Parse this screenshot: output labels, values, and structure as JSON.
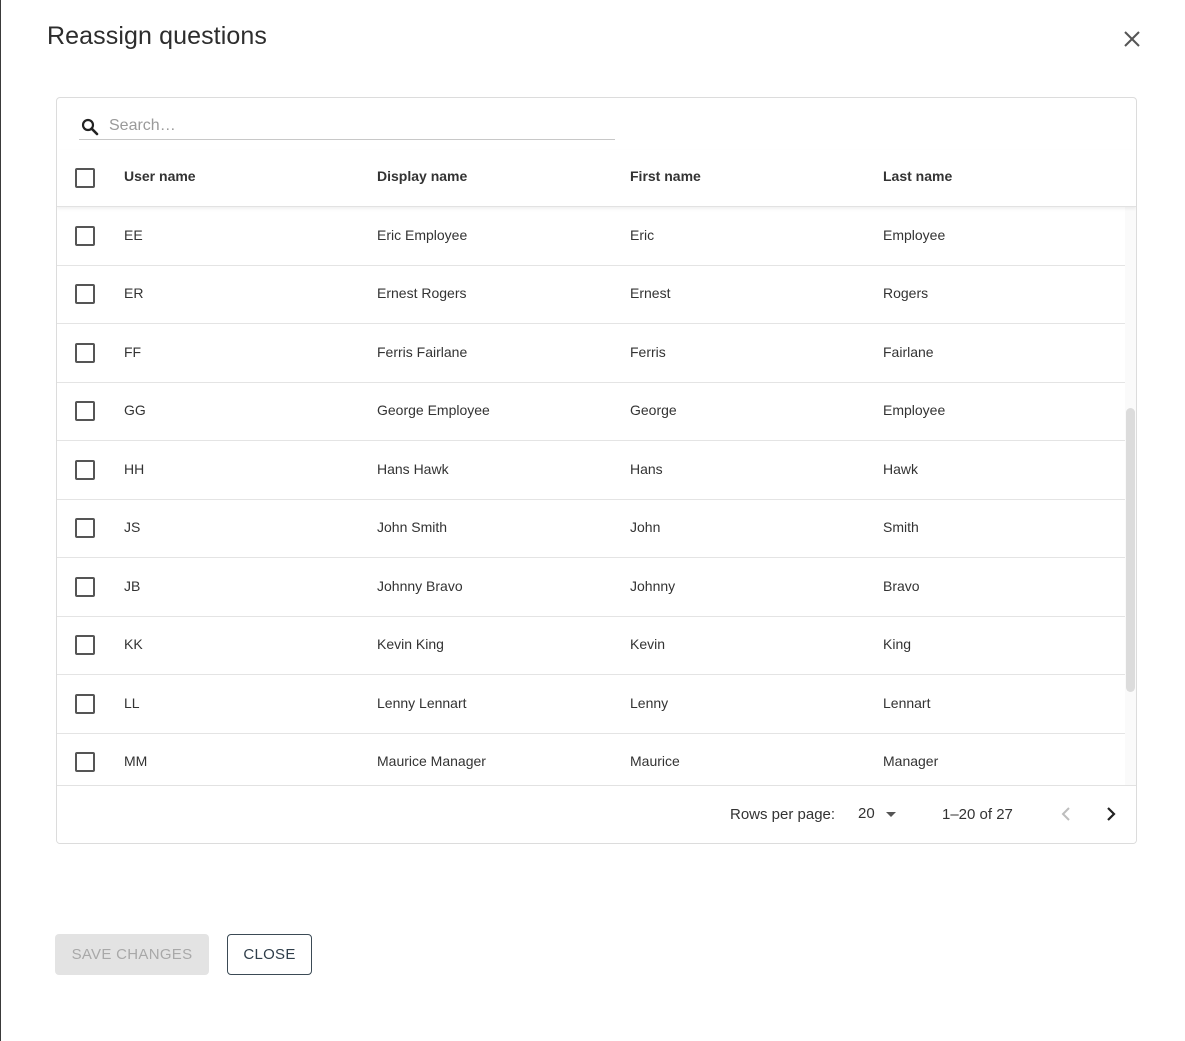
{
  "dialog": {
    "title": "Reassign questions",
    "close_icon": "close-icon"
  },
  "search": {
    "placeholder": "Search…",
    "value": "",
    "icon": "search-icon"
  },
  "table": {
    "columns": [
      "User name",
      "Display name",
      "First name",
      "Last name"
    ],
    "rows": [
      {
        "user": "EE",
        "display": "Eric Employee",
        "first": "Eric",
        "last": "Employee",
        "checked": false
      },
      {
        "user": "ER",
        "display": "Ernest Rogers",
        "first": "Ernest",
        "last": "Rogers",
        "checked": false
      },
      {
        "user": "FF",
        "display": "Ferris Fairlane",
        "first": "Ferris",
        "last": "Fairlane",
        "checked": false
      },
      {
        "user": "GG",
        "display": "George Employee",
        "first": "George",
        "last": "Employee",
        "checked": false
      },
      {
        "user": "HH",
        "display": "Hans Hawk",
        "first": "Hans",
        "last": "Hawk",
        "checked": false
      },
      {
        "user": "JS",
        "display": "John Smith",
        "first": "John",
        "last": "Smith",
        "checked": false
      },
      {
        "user": "JB",
        "display": "Johnny Bravo",
        "first": "Johnny",
        "last": "Bravo",
        "checked": false
      },
      {
        "user": "KK",
        "display": "Kevin King",
        "first": "Kevin",
        "last": "King",
        "checked": false
      },
      {
        "user": "LL",
        "display": "Lenny Lennart",
        "first": "Lenny",
        "last": "Lennart",
        "checked": false
      },
      {
        "user": "MM",
        "display": "Maurice Manager",
        "first": "Maurice",
        "last": "Manager",
        "checked": false
      }
    ]
  },
  "pagination": {
    "rows_per_page_label": "Rows per page:",
    "rows_per_page_value": "20",
    "range": "1–20 of 27",
    "prev_icon": "chevron-left-icon",
    "next_icon": "chevron-right-icon"
  },
  "actions": {
    "save_label": "SAVE CHANGES",
    "close_label": "CLOSE"
  },
  "colors": {
    "save_disabled_bg": "#e3e3e3",
    "close_border": "#3b4a55"
  }
}
